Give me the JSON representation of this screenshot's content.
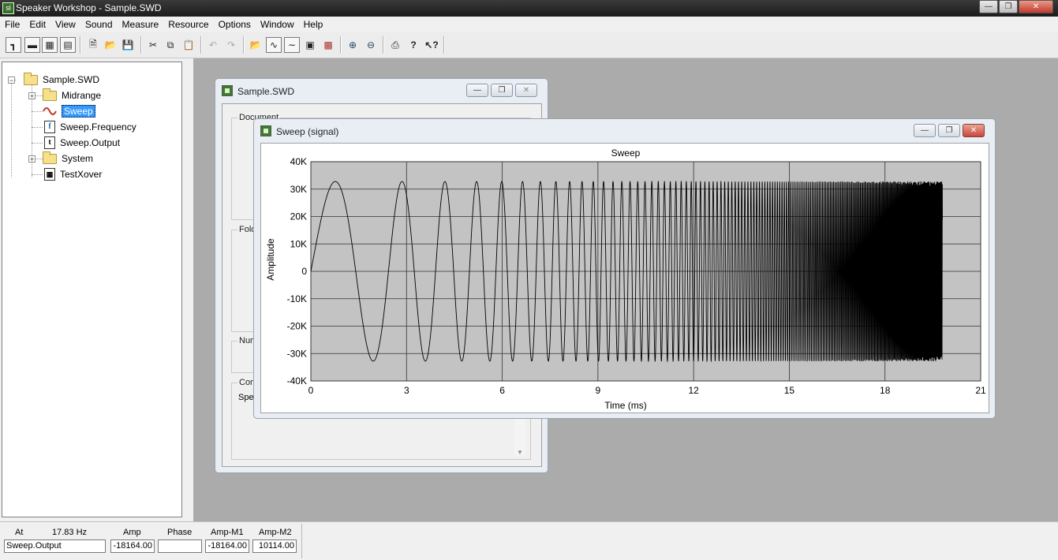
{
  "app": {
    "title": "Speaker Workshop - Sample.SWD",
    "icon": "speaker-workshop-app-icon"
  },
  "menu": [
    "File",
    "Edit",
    "View",
    "Sound",
    "Measure",
    "Resource",
    "Options",
    "Window",
    "Help"
  ],
  "toolbar": {
    "icons": [
      "tree-view-icon",
      "view-toggle-icon",
      "view-grid-icon",
      "view-list-icon",
      "new-file-icon",
      "open-folder-icon",
      "save-icon",
      "cut-icon",
      "copy-icon",
      "paste-icon",
      "undo-icon",
      "redo-icon",
      "open-object-icon",
      "signal-view-icon",
      "chart-view-icon",
      "properties-icon",
      "delete-object-icon",
      "zoom-in-icon",
      "zoom-out-icon",
      "print-icon",
      "help-icon",
      "context-help-icon"
    ]
  },
  "tree": {
    "root": "Sample.SWD",
    "items": [
      {
        "label": "Midrange",
        "icon": "folder-icon",
        "expandable": true
      },
      {
        "label": "Sweep",
        "icon": "sine-wave-icon",
        "selected": true
      },
      {
        "label": "Sweep.Frequency",
        "icon": "frequency-doc-icon"
      },
      {
        "label": "Sweep.Output",
        "icon": "time-doc-icon"
      },
      {
        "label": "System",
        "icon": "folder-icon",
        "expandable": true
      },
      {
        "label": "TestXover",
        "icon": "crossover-doc-icon"
      }
    ]
  },
  "sample_window": {
    "title": "Sample.SWD",
    "groups": [
      "Document",
      "Fold",
      "Num",
      "Com"
    ],
    "partial_text": "Spe"
  },
  "sweep_window": {
    "title": "Sweep (signal)"
  },
  "chart_data": {
    "type": "line",
    "title": "Sweep",
    "xlabel": "Time (ms)",
    "ylabel": "Amplitude",
    "xlim": [
      0,
      21
    ],
    "ylim": [
      -40000,
      40000
    ],
    "x_ticks": [
      "0",
      "3",
      "6",
      "9",
      "12",
      "15",
      "18",
      "21"
    ],
    "y_ticks": [
      "40K",
      "30K",
      "20K",
      "10K",
      "0",
      "-10K",
      "-20K",
      "-30K",
      "-40K"
    ],
    "grid": true,
    "series": [
      {
        "kind": "log-sine-sweep",
        "amplitude": 32768,
        "t_start_ms": 0,
        "t_end_ms": 19.8,
        "first_peak_ms": 0.85,
        "cycles": 175
      }
    ]
  },
  "statusbar": {
    "at_label": "At",
    "freq": "17.83 Hz",
    "amp_label": "Amp",
    "phase_label": "Phase",
    "ampm1_label": "Amp-M1",
    "ampm2_label": "Amp-M2",
    "name_value": "Sweep.Output",
    "amp_value": "-18164.00",
    "phase_value": "",
    "ampm1_value": "-18164.00",
    "ampm2_value": "10114.00"
  }
}
